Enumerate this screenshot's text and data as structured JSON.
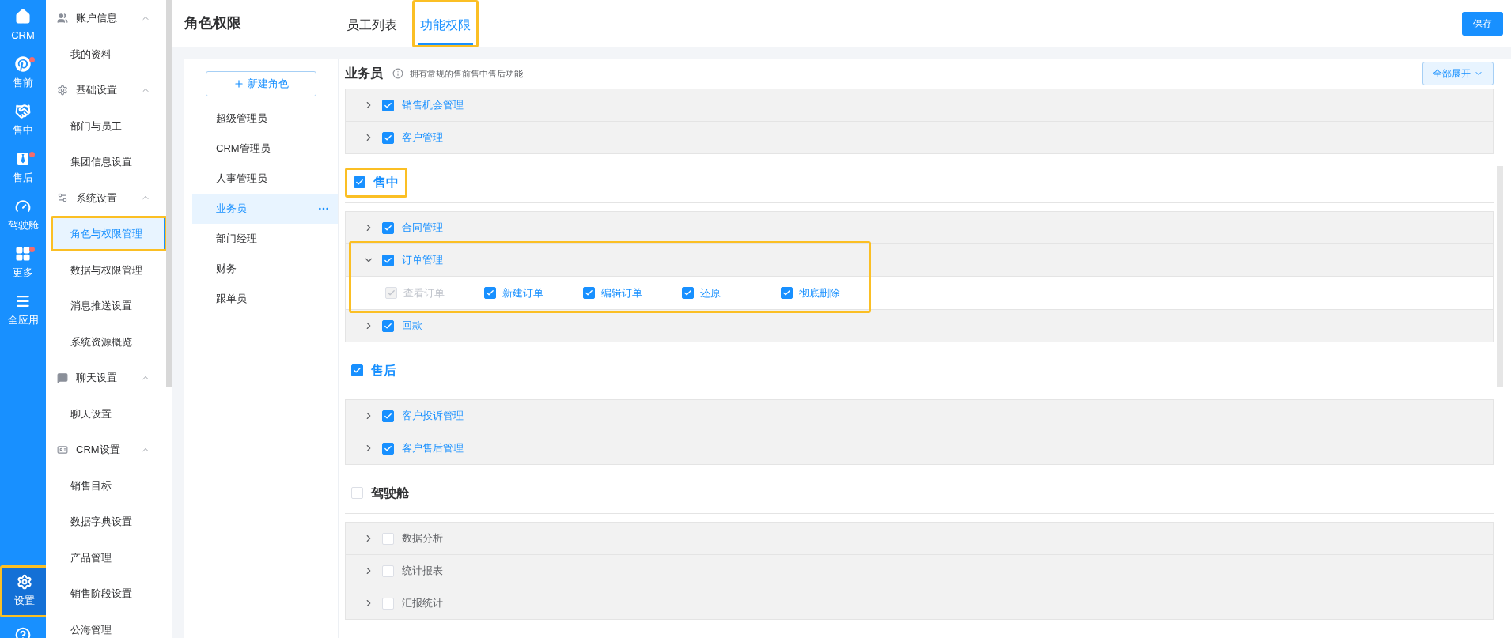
{
  "rail": {
    "items": [
      {
        "label": "CRM",
        "badge": false,
        "selected": false,
        "highlighted": false
      },
      {
        "label": "售前",
        "badge": true,
        "selected": false,
        "highlighted": false
      },
      {
        "label": "售中",
        "badge": false,
        "selected": false,
        "highlighted": false
      },
      {
        "label": "售后",
        "badge": true,
        "selected": false,
        "highlighted": false
      },
      {
        "label": "驾驶舱",
        "badge": false,
        "selected": false,
        "highlighted": false
      },
      {
        "label": "更多",
        "badge": true,
        "selected": false,
        "highlighted": false
      },
      {
        "label": "全应用",
        "badge": false,
        "selected": false,
        "highlighted": false
      }
    ],
    "bottom": {
      "label": "设置",
      "badge": false,
      "selected": true,
      "highlighted": true
    }
  },
  "menu": {
    "groups": [
      {
        "title": "账户信息",
        "expanded": true,
        "children": [
          {
            "label": "我的资料",
            "selected": false,
            "highlighted": false
          }
        ]
      },
      {
        "title": "基础设置",
        "expanded": true,
        "children": [
          {
            "label": "部门与员工",
            "selected": false,
            "highlighted": false
          },
          {
            "label": "集团信息设置",
            "selected": false,
            "highlighted": false
          }
        ]
      },
      {
        "title": "系统设置",
        "expanded": true,
        "children": [
          {
            "label": "角色与权限管理",
            "selected": true,
            "highlighted": true
          },
          {
            "label": "数据与权限管理",
            "selected": false,
            "highlighted": false
          },
          {
            "label": "消息推送设置",
            "selected": false,
            "highlighted": false
          },
          {
            "label": "系统资源概览",
            "selected": false,
            "highlighted": false
          }
        ]
      },
      {
        "title": "聊天设置",
        "expanded": true,
        "children": [
          {
            "label": "聊天设置",
            "selected": false,
            "highlighted": false
          }
        ]
      },
      {
        "title": "CRM设置",
        "expanded": true,
        "children": [
          {
            "label": "销售目标",
            "selected": false,
            "highlighted": false
          },
          {
            "label": "数据字典设置",
            "selected": false,
            "highlighted": false
          },
          {
            "label": "产品管理",
            "selected": false,
            "highlighted": false
          },
          {
            "label": "销售阶段设置",
            "selected": false,
            "highlighted": false
          },
          {
            "label": "公海管理",
            "selected": false,
            "highlighted": false
          }
        ]
      }
    ]
  },
  "header": {
    "title": "角色权限",
    "tabs": [
      {
        "label": "员工列表",
        "selected": false,
        "highlighted": false
      },
      {
        "label": "功能权限",
        "selected": true,
        "highlighted": true
      }
    ],
    "save_button": "保存"
  },
  "roles": {
    "new_role_button": "新建角色",
    "items": [
      {
        "label": "超级管理员",
        "selected": false
      },
      {
        "label": "CRM管理员",
        "selected": false
      },
      {
        "label": "人事管理员",
        "selected": false
      },
      {
        "label": "业务员",
        "selected": true
      },
      {
        "label": "部门经理",
        "selected": false
      },
      {
        "label": "财务",
        "selected": false
      },
      {
        "label": "跟单员",
        "selected": false
      }
    ]
  },
  "permissions": {
    "role_title": "业务员",
    "description": "拥有常规的售前售中售后功能",
    "expand_all_button": "全部展开",
    "groups": [
      {
        "items": [
          {
            "label": "销售机会管理",
            "checked": true,
            "expanded": false,
            "highlighted": false
          },
          {
            "label": "客户管理",
            "checked": true,
            "expanded": false,
            "highlighted": false
          }
        ]
      },
      {
        "title": "售中",
        "checked": true,
        "highlighted": true,
        "items": [
          {
            "label": "合同管理",
            "checked": true,
            "expanded": false,
            "highlighted": false
          },
          {
            "label": "订单管理",
            "checked": true,
            "expanded": true,
            "highlighted": true,
            "children": [
              {
                "label": "查看订单",
                "checked": true,
                "disabled": true
              },
              {
                "label": "新建订单",
                "checked": true,
                "disabled": false
              },
              {
                "label": "编辑订单",
                "checked": true,
                "disabled": false
              },
              {
                "label": "还原",
                "checked": true,
                "disabled": false
              },
              {
                "label": "彻底删除",
                "checked": true,
                "disabled": false
              }
            ]
          },
          {
            "label": "回款",
            "checked": true,
            "expanded": false,
            "highlighted": false
          }
        ]
      },
      {
        "title": "售后",
        "checked": true,
        "highlighted": false,
        "items": [
          {
            "label": "客户投诉管理",
            "checked": true,
            "expanded": false,
            "highlighted": false
          },
          {
            "label": "客户售后管理",
            "checked": true,
            "expanded": false,
            "highlighted": false
          }
        ]
      },
      {
        "title": "驾驶舱",
        "checked": false,
        "highlighted": false,
        "items": [
          {
            "label": "数据分析",
            "checked": false,
            "expanded": false,
            "highlighted": false
          },
          {
            "label": "统计报表",
            "checked": false,
            "expanded": false,
            "highlighted": false
          },
          {
            "label": "汇报统计",
            "checked": false,
            "expanded": false,
            "highlighted": false
          }
        ]
      }
    ]
  }
}
